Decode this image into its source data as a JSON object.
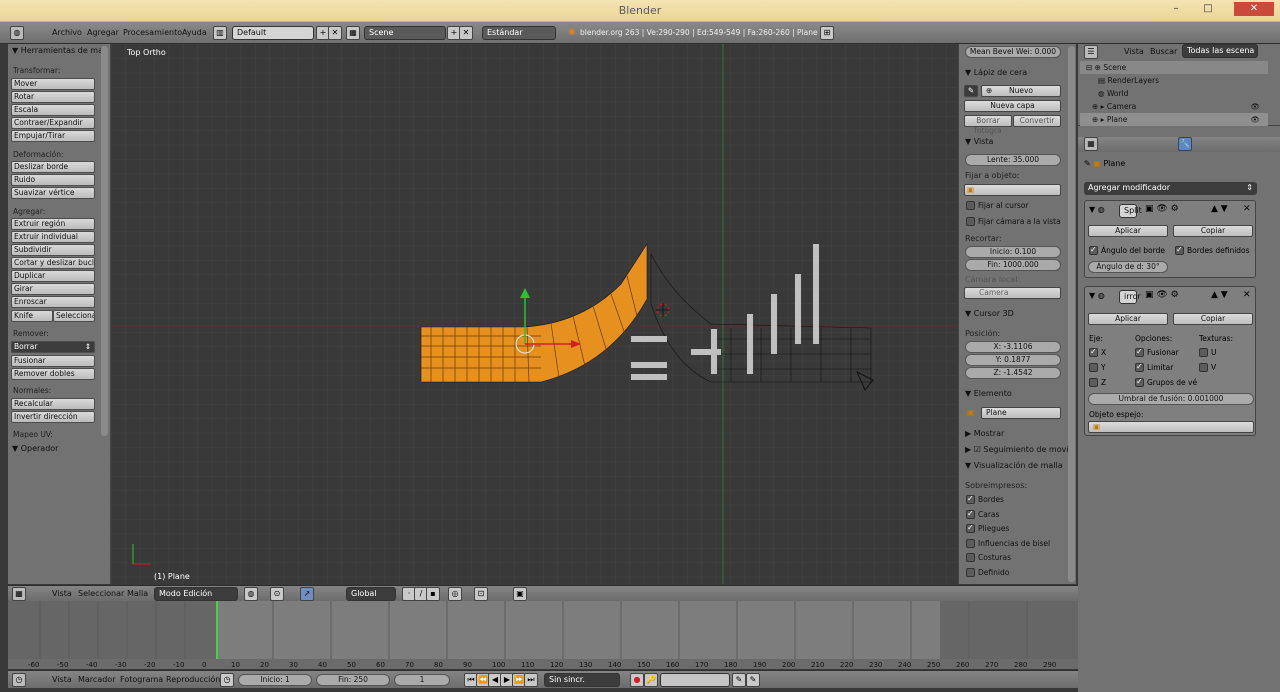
{
  "window": {
    "title": "Blender"
  },
  "infobar": {
    "menus": [
      "Archivo",
      "Agregar",
      "Procesamiento",
      "Ayuda"
    ],
    "layout": "Default",
    "scene": "Scene",
    "engine": "Estándar",
    "stats": "blender.org 263 | Ve:290-290 | Ed:549-549 | Fa:260-260 | Plane"
  },
  "toolshelf": {
    "title": "Herramientas de ma",
    "transform_label": "Transformar:",
    "transform": [
      "Mover",
      "Rotar",
      "Escala",
      "Contraer/Expandir",
      "Empujar/Tirar"
    ],
    "deform_label": "Deformación:",
    "deform": [
      "Deslizar borde",
      "Ruido",
      "Suavizar vértice"
    ],
    "add_label": "Agregar:",
    "add": [
      "Extruir región",
      "Extruir individual",
      "Subdividir",
      "Cortar y deslizar bucle",
      "Duplicar",
      "Girar",
      "Enroscar"
    ],
    "knife": "Knife",
    "select": "Seleccionar",
    "remove_label": "Remover:",
    "delete": "Borrar",
    "merge": "Fusionar",
    "remove_doubles": "Remover dobles",
    "normals_label": "Normales:",
    "normals": [
      "Recalcular",
      "Invertir dirección"
    ],
    "uv_label": "Mapeo UV:",
    "operator": "Operador"
  },
  "viewport": {
    "view_label": "Top Ortho",
    "object_label": "(1) Plane"
  },
  "npanel": {
    "bevel": "Mean Bevel Wei: 0.000",
    "grease": "Lápiz de cera",
    "new": "Nuevo",
    "new_layer": "Nueva capa",
    "clear": "Borrar fotogra",
    "convert": "Convertir",
    "view": "Vista",
    "lens": "Lente: 35.000",
    "lock_obj": "Fijar a objeto:",
    "lock_cursor": "Fijar al cursor",
    "lock_cam": "Fijar cámara a la vista",
    "clip": "Recortar:",
    "clip_start": "Inicio: 0.100",
    "clip_end": "Fin: 1000.000",
    "local_cam": "Cámara local:",
    "camera": "Camera",
    "cursor": "Cursor 3D",
    "location": "Posición:",
    "cx": "X: -3.1106",
    "cy": "Y: 0.1877",
    "cz": "Z: -1.4542",
    "item": "Elemento",
    "item_name": "Plane",
    "display": "Mostrar",
    "motion": "Seguimiento de movi",
    "mesh_display": "Visualización de malla",
    "overlays": "Sobreimpresos:",
    "checks": [
      {
        "label": "Bordes",
        "on": true
      },
      {
        "label": "Caras",
        "on": true
      },
      {
        "label": "Pliegues",
        "on": true
      },
      {
        "label": "Influencias de bisel",
        "on": false
      },
      {
        "label": "Costuras",
        "on": false
      },
      {
        "label": "Definido",
        "on": false
      }
    ]
  },
  "outliner": {
    "view": "Vista",
    "search": "Buscar",
    "filter": "Todas las escena",
    "items": [
      "Scene",
      "RenderLayers",
      "World",
      "Camera",
      "Plane"
    ]
  },
  "properties": {
    "object": "Plane",
    "add_modifier": "Agregar modificador",
    "mod1_name": "Split",
    "apply": "Aplicar",
    "copy": "Copiar",
    "edge_angle": "Ángulo del borde",
    "sharp_edges": "Bordes definidos",
    "split_angle": "Ángulo de d: 30°",
    "mod2_name": "irror",
    "axis": "Eje:",
    "options": "Opciones:",
    "textures": "Texturas:",
    "x": "X",
    "y": "Y",
    "z": "Z",
    "merge": "Fusionar",
    "clipping": "Limitar",
    "vgroups": "Grupos de vé",
    "u": "U",
    "v": "V",
    "merge_limit": "Umbral de fusión: 0.001000",
    "mirror_obj": "Objeto espejo:"
  },
  "header3d": {
    "menus": [
      "Vista",
      "Seleccionar",
      "Malla"
    ],
    "mode": "Modo Edición",
    "orient": "Global"
  },
  "timeline": {
    "ticks": [
      "-60",
      "-40",
      "-20",
      "0",
      "20",
      "40",
      "60",
      "80",
      "100",
      "120",
      "140",
      "160",
      "180",
      "200",
      "220",
      "240",
      "260",
      "280"
    ],
    "ticks_odd": [
      "-50",
      "-30",
      "-10",
      "10",
      "30",
      "50",
      "70",
      "90",
      "110",
      "130",
      "150",
      "170",
      "190",
      "210",
      "230",
      "250",
      "270",
      "290"
    ]
  },
  "bottombar": {
    "menus": [
      "Vista",
      "Marcador",
      "Fotograma",
      "Reproducción"
    ],
    "start": "Inicio: 1",
    "end": "Fin: 250",
    "current": "1",
    "sync": "Sin sincr."
  }
}
